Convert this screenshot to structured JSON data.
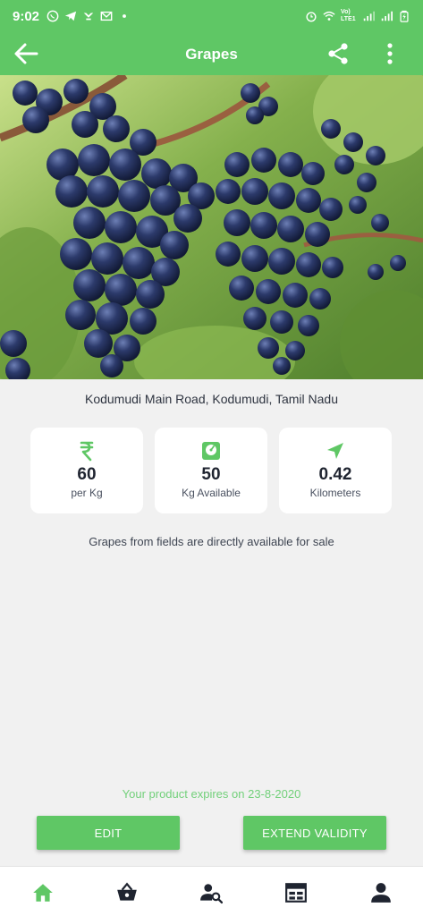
{
  "status_bar": {
    "time": "9:02",
    "left_icons": [
      "whatsapp-icon",
      "telegram-icon",
      "app-icon",
      "gmail-icon",
      "dot-icon"
    ],
    "right_icons": [
      "alarm-icon",
      "wifi-icon",
      "volte-icon",
      "signal-icon",
      "signal-icon",
      "battery-icon"
    ],
    "network_label": "Vo) LTE1"
  },
  "app_bar": {
    "title": "Grapes",
    "back_icon": "arrow-back-icon",
    "share_icon": "share-icon",
    "more_icon": "more-vert-icon"
  },
  "product": {
    "location": "Kodumudi Main Road, Kodumudi, Tamil Nadu",
    "stats": [
      {
        "icon": "rupee-icon",
        "value": "60",
        "label": "per Kg"
      },
      {
        "icon": "scale-icon",
        "value": "50",
        "label": "Kg Available"
      },
      {
        "icon": "navigation-icon",
        "value": "0.42",
        "label": "Kilometers"
      }
    ],
    "description": "Grapes from fields are directly available for sale",
    "expiry": "Your product expires on 23-8-2020"
  },
  "actions": {
    "edit_label": "EDIT",
    "extend_label": "EXTEND VALIDITY"
  },
  "bottom_nav": {
    "items": [
      {
        "icon": "home-icon",
        "active": true
      },
      {
        "icon": "basket-icon",
        "active": false
      },
      {
        "icon": "user-search-icon",
        "active": false
      },
      {
        "icon": "calendar-icon",
        "active": false
      },
      {
        "icon": "profile-icon",
        "active": false
      }
    ]
  },
  "colors": {
    "primary": "#5fc765",
    "accent_text": "#72d07a",
    "background": "#f1f1f1",
    "nav_icon": "#1f2430"
  }
}
